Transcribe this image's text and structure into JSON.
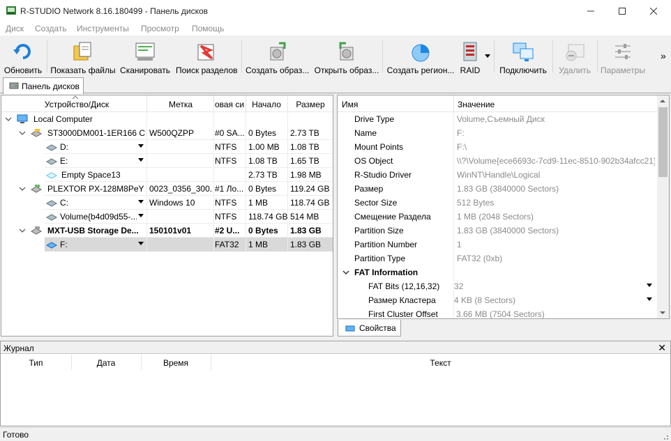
{
  "window": {
    "title": "R-STUDIO Network 8.16.180499 - Панель дисков"
  },
  "menu": [
    "Диск",
    "Создать",
    "Инструменты",
    "Просмотр",
    "Помощь"
  ],
  "toolbar": {
    "refresh": "Обновить",
    "show_files": "Показать файлы",
    "scan": "Сканировать",
    "find_partitions": "Поиск разделов",
    "create_image": "Создать образ...",
    "open_image": "Открыть образ...",
    "create_region": "Создать регион...",
    "raid": "RAID",
    "connect": "Подключить",
    "remove": "Удалить",
    "params": "Параметры",
    "more": "»"
  },
  "tabs": {
    "disks_panel": "Панель дисков",
    "properties": "Свойства"
  },
  "devices": {
    "columns": [
      "Устройство/Диск",
      "Метка",
      "овая си",
      "Начало",
      "Размер"
    ],
    "rows": [
      {
        "name": "Local Computer",
        "label": "",
        "fs": "",
        "start": "",
        "size": ""
      },
      {
        "name": "ST3000DM001-1ER166 C...",
        "label": "W500QZPP",
        "fs": "#0 SA...",
        "start": "0 Bytes",
        "size": "2.73 TB"
      },
      {
        "name": "D:",
        "label": "",
        "fs": "NTFS",
        "start": "1.00 MB",
        "size": "1.08 TB"
      },
      {
        "name": "E:",
        "label": "",
        "fs": "NTFS",
        "start": "1.08 TB",
        "size": "1.65 TB"
      },
      {
        "name": "Empty Space13",
        "label": "",
        "fs": "",
        "start": "2.73 TB",
        "size": "1.98 MB"
      },
      {
        "name": "PLEXTOR PX-128M8PeY ...",
        "label": "0023_0356_300...",
        "fs": "#1 Ло...",
        "start": "0 Bytes",
        "size": "119.24 GB"
      },
      {
        "name": "C:",
        "label": "Windows 10",
        "fs": "NTFS",
        "start": "1 MB",
        "size": "118.74 GB"
      },
      {
        "name": "Volume{b4d09d55-...",
        "label": "",
        "fs": "NTFS",
        "start": "118.74 GB",
        "size": "514 MB"
      },
      {
        "name": "MXT-USB Storage De...",
        "label": "150101v01",
        "fs": "#2 U...",
        "start": "0 Bytes",
        "size": "1.83 GB"
      },
      {
        "name": "F:",
        "label": "",
        "fs": "FAT32",
        "start": "1 MB",
        "size": "1.83 GB"
      }
    ]
  },
  "properties": {
    "columns": [
      "Имя",
      "Значение"
    ],
    "rows": [
      {
        "name": "Drive Type",
        "value": "Volume,Съемный Диск"
      },
      {
        "name": "Name",
        "value": "F:"
      },
      {
        "name": "Mount Points",
        "value": "F:\\"
      },
      {
        "name": "OS Object",
        "value": "\\\\?\\Volume{ece6693c-7cd9-11ec-8510-902b34afcc21}"
      },
      {
        "name": "R-Studio Driver",
        "value": "WinNT\\Handle\\Logical"
      },
      {
        "name": "Размер",
        "value": "1.83 GB (3840000 Sectors)"
      },
      {
        "name": "Sector Size",
        "value": "512 Bytes"
      },
      {
        "name": "Смещение Раздела",
        "value": "1 MB (2048 Sectors)"
      },
      {
        "name": "Partition Size",
        "value": "1.83 GB (3840000 Sectors)"
      },
      {
        "name": "Partition Number",
        "value": "1"
      },
      {
        "name": "Partition Type",
        "value": "FAT32 (0xb)"
      },
      {
        "name": "FAT Information",
        "value": ""
      },
      {
        "name": "FAT Bits (12,16,32)",
        "value": "32"
      },
      {
        "name": "Размер Кластера",
        "value": "4 KB (8 Sectors)"
      },
      {
        "name": "First Cluster Offset",
        "value": "3.66 MB (7504 Sectors)"
      }
    ]
  },
  "journal": {
    "title": "Журнал",
    "close": "✕",
    "columns": [
      "Тип",
      "Дата",
      "Время",
      "Текст"
    ]
  },
  "status": "Готово"
}
